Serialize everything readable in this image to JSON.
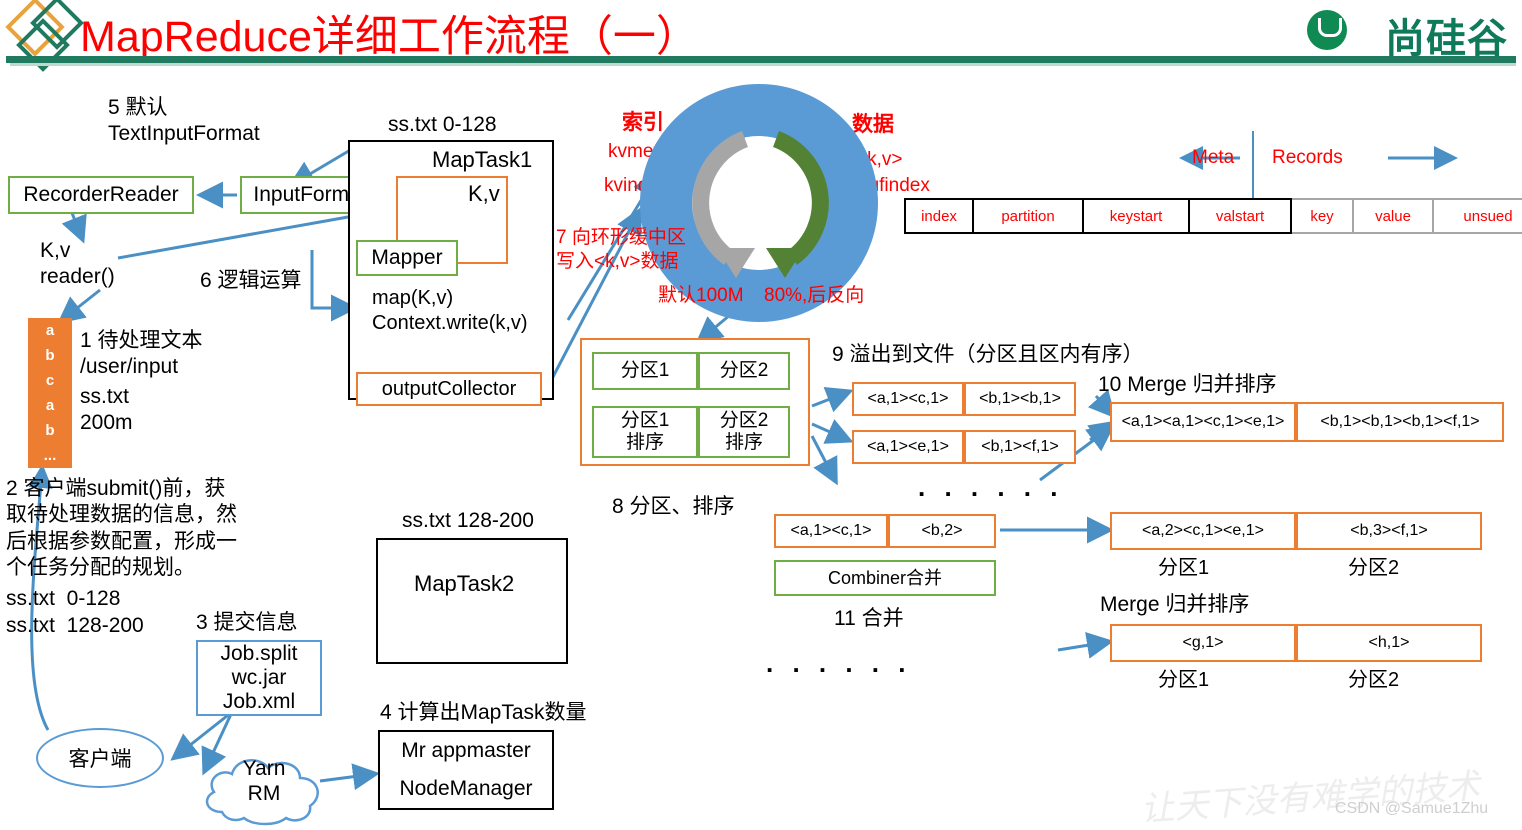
{
  "header": {
    "title": "MapReduce详细工作流程（一）",
    "brand": "尚硅谷",
    "title_color": "#ff0000",
    "brand_color": "#0e7a5a",
    "rule_color": "#1f7a5f"
  },
  "watermark": {
    "text": "让天下没有难学的技术",
    "credit": "CSDN @Samue1Zhu"
  },
  "steps": {
    "s5": "5 默认\nTextInputFormat",
    "s6": "6 逻辑运算",
    "s1": "1 待处理文本\n/user/input",
    "s2": "2 客户端submit()前，获\n取待处理数据的信息，然\n后根据参数配置，形成一\n个任务分配的规划。",
    "s3": "3 提交信息",
    "s4": "4 计算出MapTask数量",
    "s7": "7 向环形缓中区\n写入<k,v>数据",
    "s8": "8 分区、排序",
    "s9": "9 溢出到文件（分区且区内有序）",
    "s10": "10 Merge 归并排序",
    "s11": "11 合并"
  },
  "left": {
    "recorder_reader": "RecorderReader",
    "input_format": "InputFormat",
    "kv_reader": "K,v\nreader()",
    "file_chars": [
      "a",
      "b",
      "c",
      "a",
      "b",
      "..."
    ],
    "file_name": "ss.txt",
    "file_size": "200m",
    "split1": "ss.txt  0-128",
    "split2": "ss.txt  128-200",
    "job_files": "Job.split\nwc.jar\nJob.xml",
    "client": "客户端",
    "yarn": "Yarn\nRM",
    "appmaster": "Mr appmaster",
    "nodemanager": "NodeManager"
  },
  "maptask1": {
    "caption": "ss.txt 0-128",
    "title": "MapTask1",
    "kv": "K,v",
    "mapper": "Mapper",
    "map_code": "map(K,v)\nContext.write(k,v)",
    "output_collector": "outputCollector"
  },
  "maptask2": {
    "caption": "ss.txt 128-200",
    "title": "MapTask2"
  },
  "buffer": {
    "index_title": "索引",
    "kvmeta": "kvmeta",
    "kvindex": "kvindex",
    "data_title": "数据",
    "kv": "<k,v>",
    "bufindex": "bufindex",
    "default_size": "默认100M",
    "spill_threshold": "80%,后反向",
    "ring_color": "#5b9bd5",
    "meta_arrow_color": "#a6a6a6",
    "data_arrow_color": "#548235"
  },
  "meta_table": {
    "meta_label": "Meta",
    "records_label": "Records",
    "cells": [
      "index",
      "partition",
      "keystart",
      "valstart",
      "key",
      "value",
      "unsued"
    ]
  },
  "partitions": {
    "row1": [
      "分区1",
      "分区2"
    ],
    "row2": [
      "分区1\n排序",
      "分区2\n排序"
    ]
  },
  "spill_files": [
    [
      "<a,1><c,1>",
      "<b,1><b,1>"
    ],
    [
      "<a,1><e,1>",
      "<b,1><f,1>"
    ]
  ],
  "spill_dots": ". . .   . . .",
  "combine": {
    "row": [
      "<a,1><c,1>",
      "<b,2>"
    ],
    "combiner": "Combiner合并",
    "dots": ". . .    . . ."
  },
  "merge_top": {
    "cells": [
      "<a,1><a,1><c,1><e,1>",
      "<b,1><b,1><b,1><f,1>"
    ]
  },
  "merge_mid": {
    "cells": [
      "<a,2><c,1><e,1>",
      "<b,3><f,1>"
    ],
    "labels": [
      "分区1",
      "分区2"
    ],
    "caption": "Merge 归并排序"
  },
  "merge_bottom": {
    "cells": [
      "<g,1>",
      "<h,1>"
    ],
    "labels": [
      "分区1",
      "分区2"
    ]
  }
}
